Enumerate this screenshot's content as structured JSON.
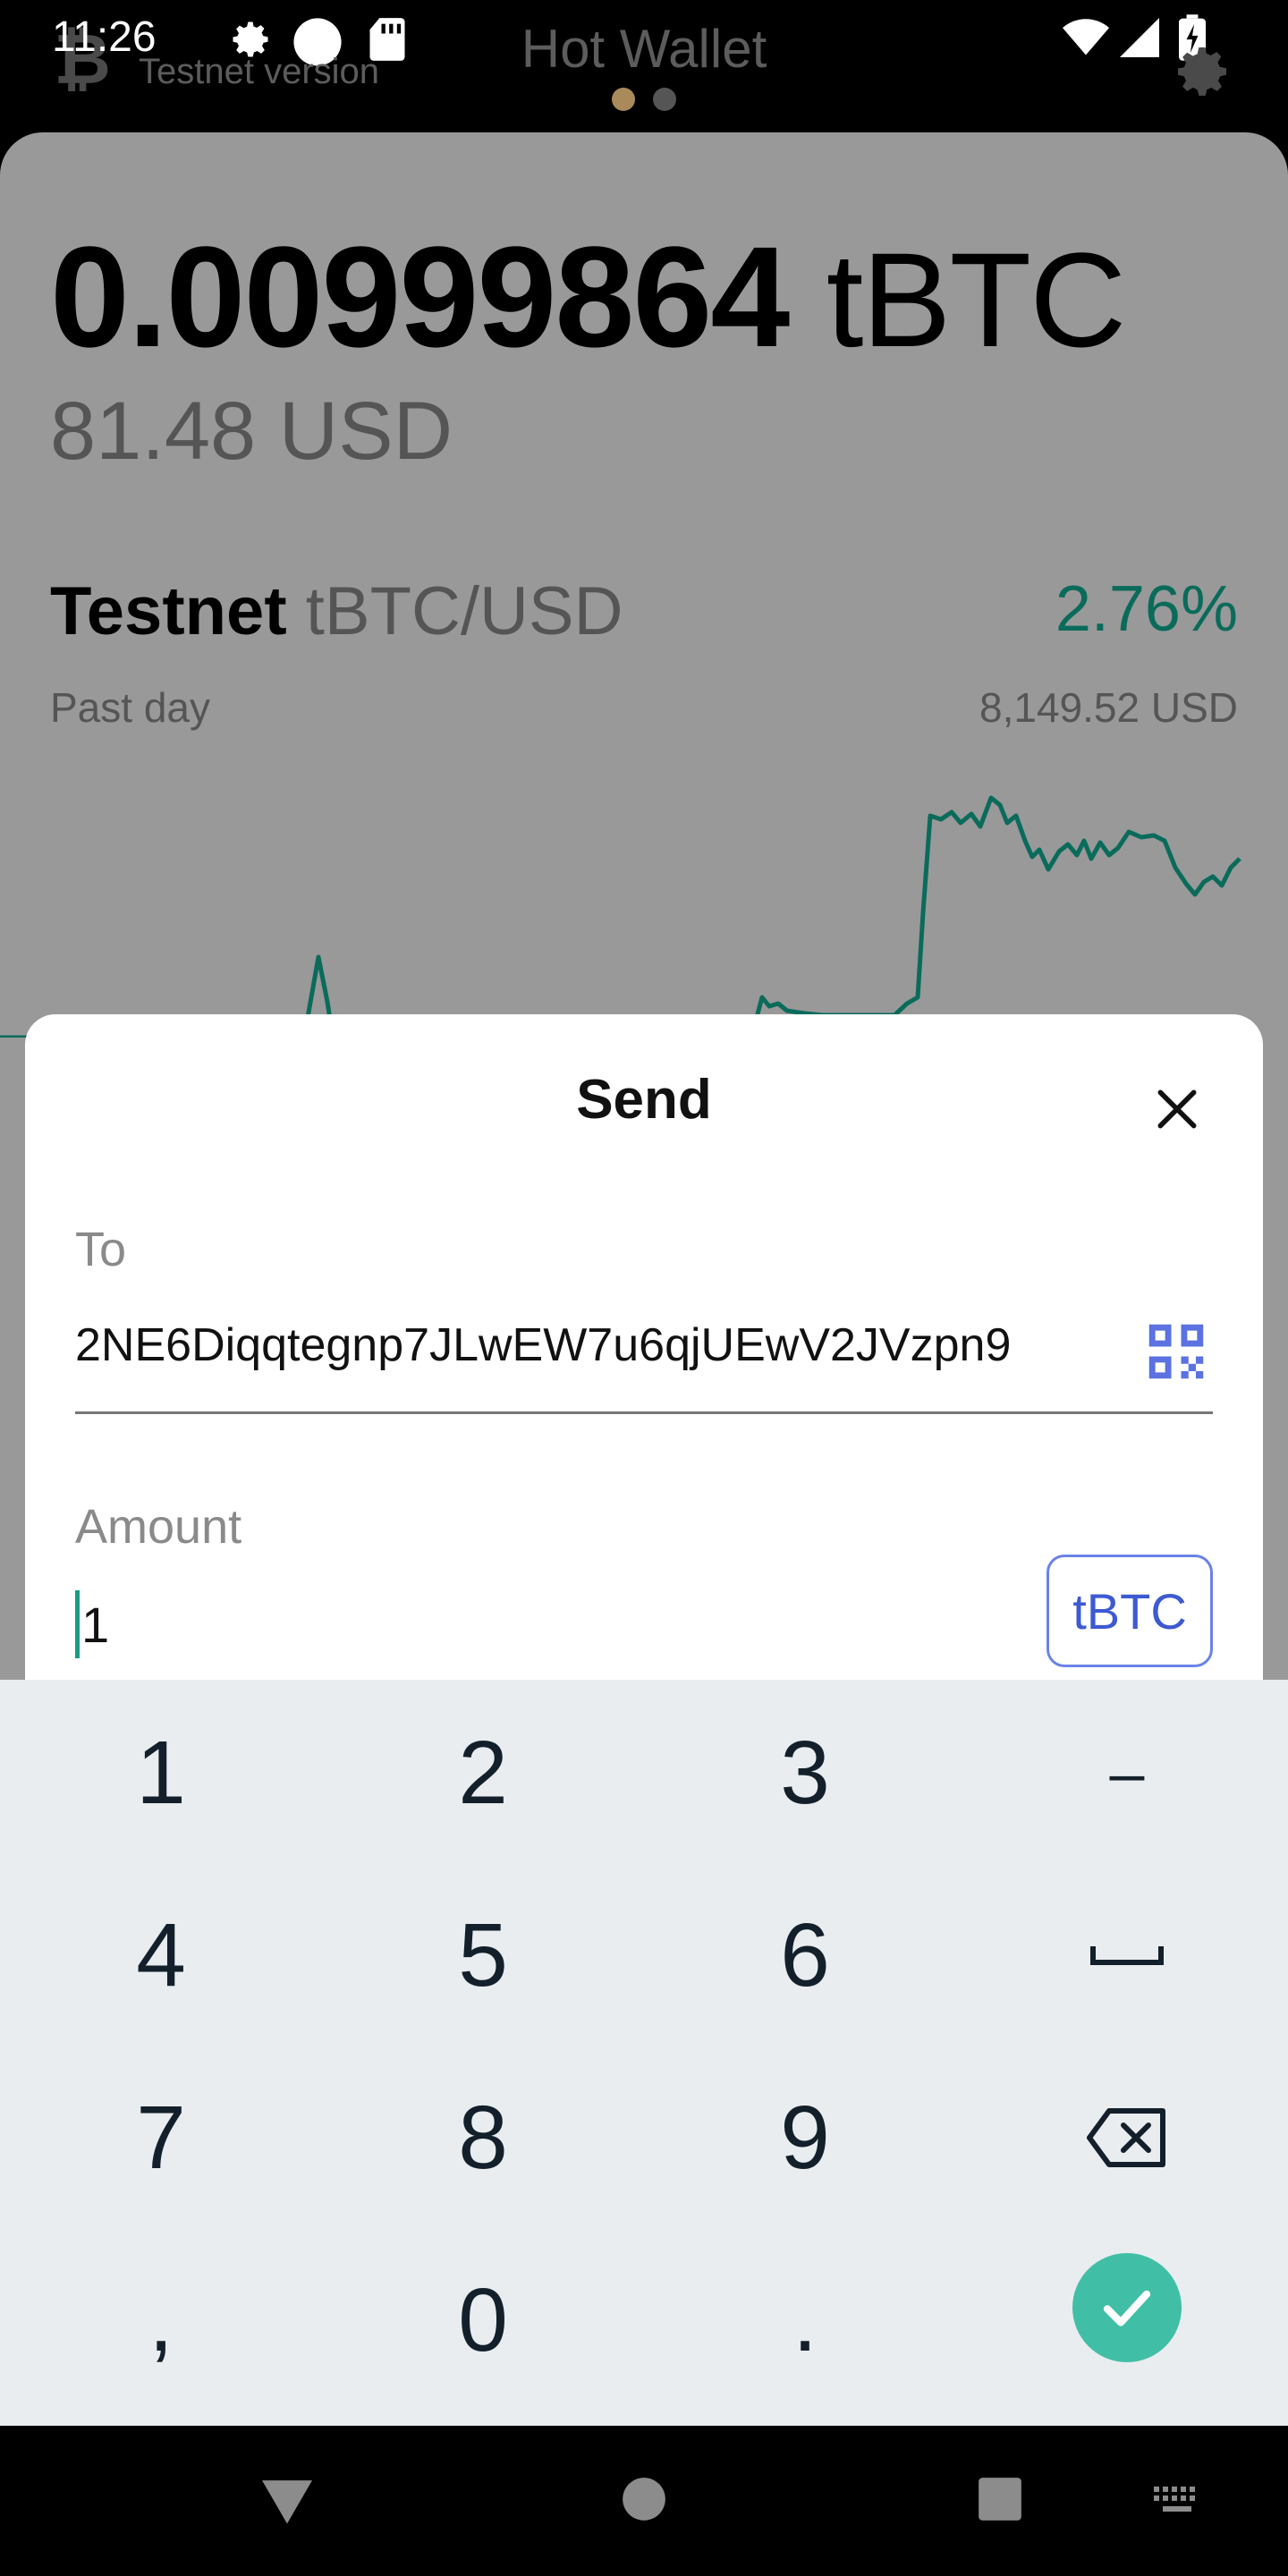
{
  "status_bar": {
    "time": "11:26"
  },
  "header": {
    "app_logo": "bitcoin-logo-icon",
    "network_label": "Testnet version",
    "title": "Hot Wallet",
    "pager_colors": [
      "#a98a5a",
      "#555555"
    ]
  },
  "wallet": {
    "balance": "0.00999864",
    "balance_unit": "tBTC",
    "balance_fiat": "81.48 USD",
    "network": "Testnet",
    "pair": "tBTC/USD",
    "change": "2.76%",
    "period": "Past day",
    "price": "8,149.52 USD",
    "chart_color": "#0a6b5b"
  },
  "send_sheet": {
    "title": "Send",
    "to_label": "To",
    "to_value": "2NE6Diqqtegnp7JLwEW7u6qjUEwV2JVzpn9",
    "amount_label": "Amount",
    "amount_value": "1",
    "unit_button": "tBTC"
  },
  "keyboard": {
    "keys": [
      "1",
      "2",
      "3",
      "–",
      "4",
      "5",
      "6",
      "␣",
      "7",
      "8",
      "9",
      "⌫",
      ",",
      "0",
      ".",
      "✓"
    ],
    "enter_color": "#41bfa6"
  },
  "navbar": {
    "icons": [
      "back-icon",
      "home-icon",
      "recents-icon",
      "keyboard-icon"
    ]
  }
}
